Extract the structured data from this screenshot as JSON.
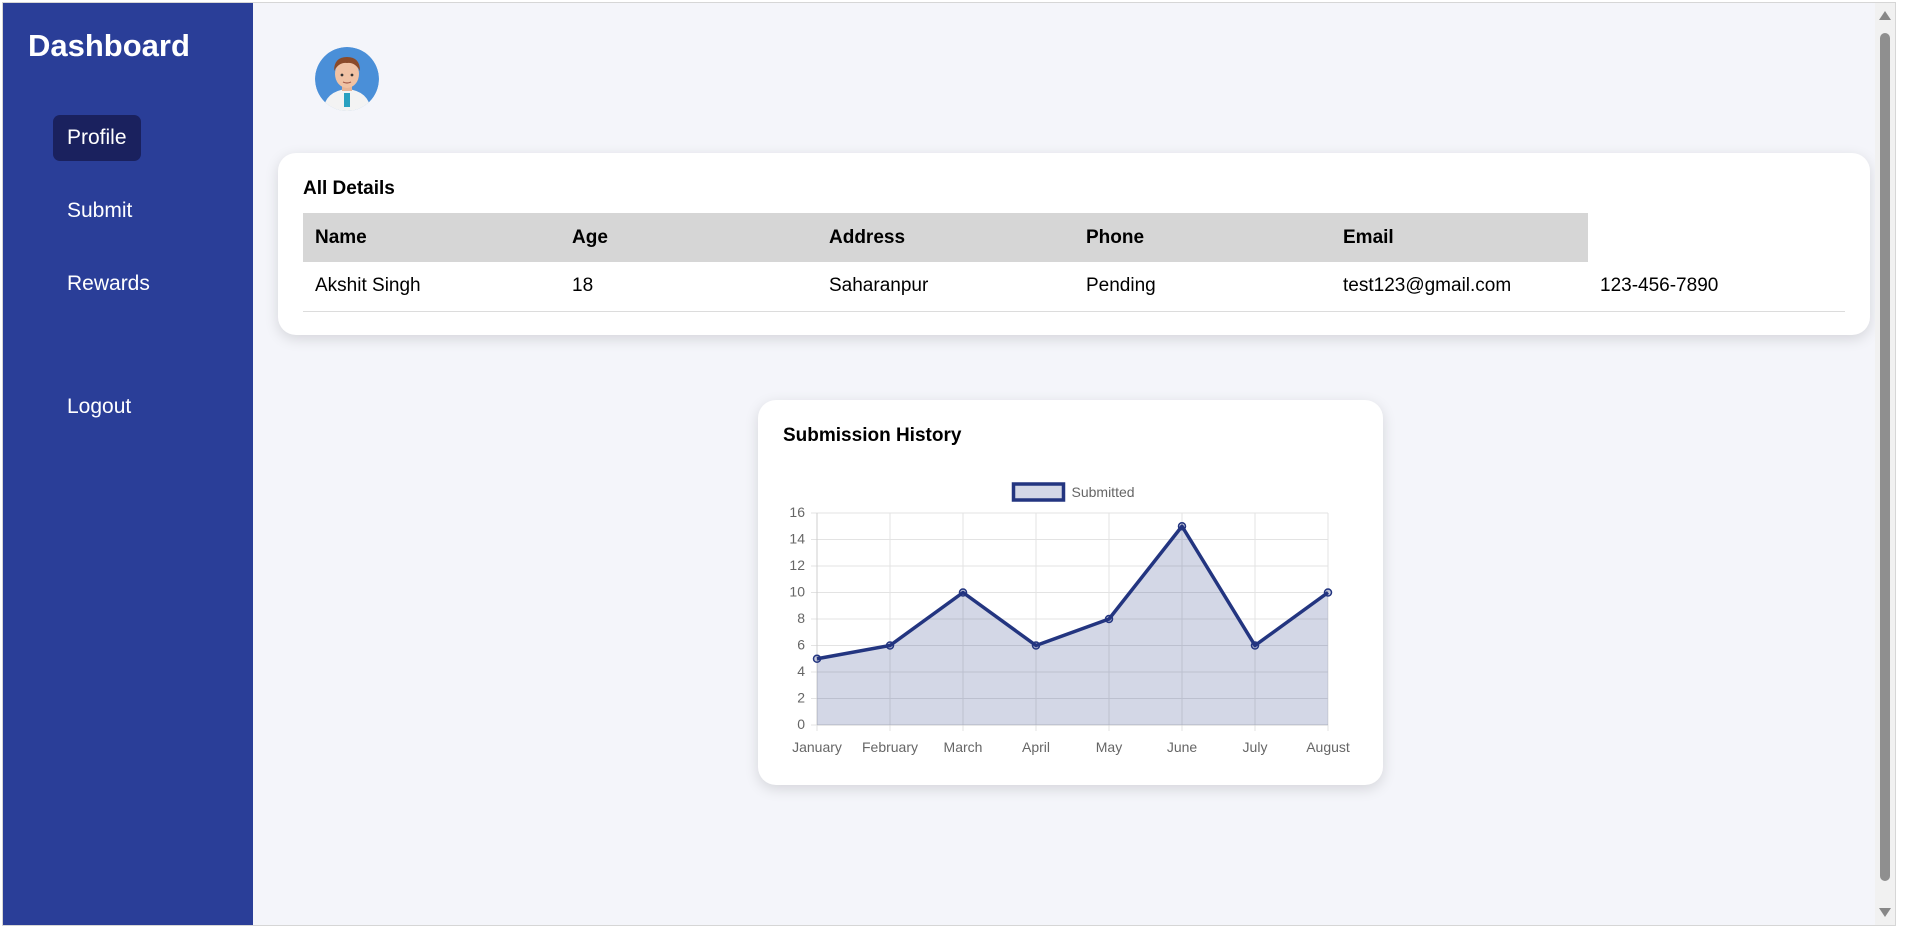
{
  "sidebar": {
    "title": "Dashboard",
    "items": [
      {
        "label": "Profile",
        "active": true
      },
      {
        "label": "Submit",
        "active": false
      },
      {
        "label": "Rewards",
        "active": false
      },
      {
        "label": "Logout",
        "active": false
      }
    ]
  },
  "avatar": {
    "icon": "user-avatar-icon"
  },
  "details": {
    "title": "All Details",
    "headers": [
      "Name",
      "Age",
      "Address",
      "Phone",
      "Email"
    ],
    "row": [
      "Akshit Singh",
      "18",
      "Saharanpur",
      "Pending",
      "test123@gmail.com",
      "123-456-7890"
    ]
  },
  "chart": {
    "title": "Submission History"
  },
  "chart_data": {
    "type": "area",
    "categories": [
      "January",
      "February",
      "March",
      "April",
      "May",
      "June",
      "July",
      "August"
    ],
    "series": [
      {
        "name": "Submitted",
        "values": [
          5,
          6,
          10,
          6,
          8,
          15,
          6,
          10
        ]
      }
    ],
    "ylim": [
      0,
      16
    ],
    "yticks": [
      0,
      2,
      4,
      6,
      8,
      10,
      12,
      14,
      16
    ],
    "grid": true,
    "legend": "top",
    "colors": {
      "line": "#233580",
      "fill": "rgba(35,53,128,0.2)"
    }
  },
  "colors": {
    "sidebar": "#2a3e98",
    "active_item": "#1a215e",
    "background": "#f4f5fa"
  }
}
